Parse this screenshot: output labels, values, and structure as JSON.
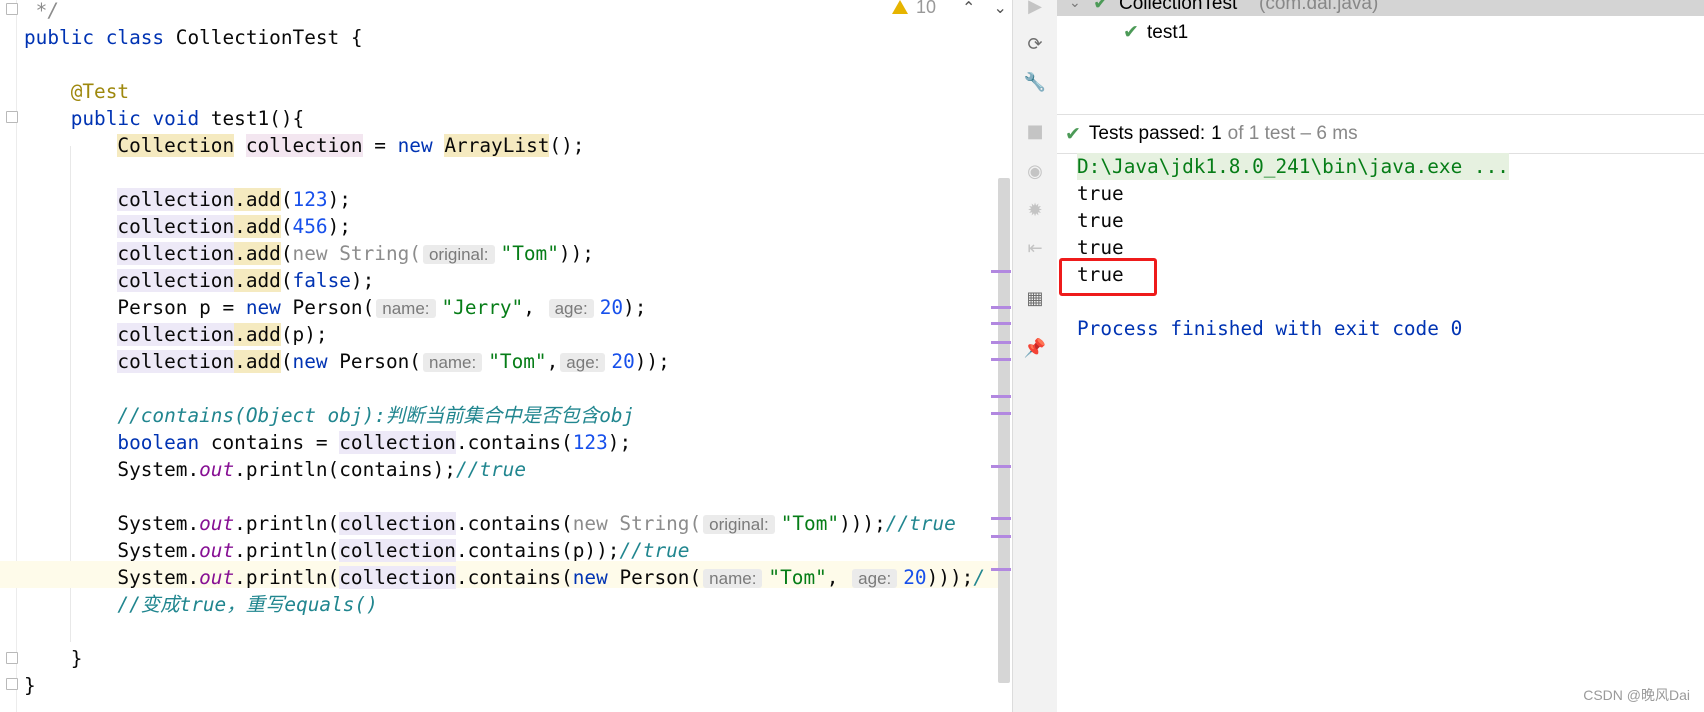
{
  "editor": {
    "lines": [
      {
        "segs": [
          {
            "t": " */",
            "c": "cmt"
          }
        ]
      },
      {
        "segs": [
          {
            "t": "public",
            "c": "kw"
          },
          {
            "t": " "
          },
          {
            "t": "class",
            "c": "kw"
          },
          {
            "t": " CollectionTest {"
          }
        ]
      },
      {
        "segs": []
      },
      {
        "segs": [
          {
            "t": "    "
          },
          {
            "t": "@Test",
            "c": "ann"
          }
        ]
      },
      {
        "segs": [
          {
            "t": "    "
          },
          {
            "t": "public",
            "c": "kw"
          },
          {
            "t": " "
          },
          {
            "t": "void",
            "c": "kw"
          },
          {
            "t": " test1(){"
          }
        ]
      },
      {
        "segs": [
          {
            "t": "        "
          },
          {
            "t": "Collection",
            "c": "hl-y"
          },
          {
            "t": " "
          },
          {
            "t": "collection",
            "c": "hl-p"
          },
          {
            "t": " = "
          },
          {
            "t": "new",
            "c": "kw"
          },
          {
            "t": " "
          },
          {
            "t": "ArrayList",
            "c": "hl-y"
          },
          {
            "t": "();"
          }
        ]
      },
      {
        "segs": []
      },
      {
        "segs": [
          {
            "t": "        "
          },
          {
            "t": "collection",
            "c": "hl-v"
          },
          {
            "t": ".add",
            "c": "hl-y"
          },
          {
            "t": "("
          },
          {
            "t": "123",
            "c": "num"
          },
          {
            "t": ");"
          }
        ]
      },
      {
        "segs": [
          {
            "t": "        "
          },
          {
            "t": "collection",
            "c": "hl-v"
          },
          {
            "t": ".add",
            "c": "hl-y"
          },
          {
            "t": "("
          },
          {
            "t": "456",
            "c": "num"
          },
          {
            "t": ");"
          }
        ]
      },
      {
        "segs": [
          {
            "t": "        "
          },
          {
            "t": "collection",
            "c": "hl-v"
          },
          {
            "t": ".add",
            "c": "hl-y"
          },
          {
            "t": "("
          },
          {
            "t": "new String(",
            "c": "gray"
          },
          {
            "t": "original:",
            "c": "hint"
          },
          {
            "t": "\"Tom\"",
            "c": "str"
          },
          {
            "t": "));"
          }
        ]
      },
      {
        "segs": [
          {
            "t": "        "
          },
          {
            "t": "collection",
            "c": "hl-v"
          },
          {
            "t": ".add",
            "c": "hl-y"
          },
          {
            "t": "("
          },
          {
            "t": "false",
            "c": "kw"
          },
          {
            "t": ");"
          }
        ]
      },
      {
        "segs": [
          {
            "t": "        Person p = "
          },
          {
            "t": "new",
            "c": "kw"
          },
          {
            "t": " Person("
          },
          {
            "t": "name:",
            "c": "hint"
          },
          {
            "t": "\"Jerry\"",
            "c": "str"
          },
          {
            "t": ", "
          },
          {
            "t": "age:",
            "c": "hint"
          },
          {
            "t": "20",
            "c": "num"
          },
          {
            "t": ");"
          }
        ]
      },
      {
        "segs": [
          {
            "t": "        "
          },
          {
            "t": "collection",
            "c": "hl-v"
          },
          {
            "t": ".add",
            "c": "hl-y"
          },
          {
            "t": "(p);"
          }
        ]
      },
      {
        "segs": [
          {
            "t": "        "
          },
          {
            "t": "collection",
            "c": "hl-v"
          },
          {
            "t": ".add",
            "c": "hl-y"
          },
          {
            "t": "("
          },
          {
            "t": "new",
            "c": "kw"
          },
          {
            "t": " Person("
          },
          {
            "t": "name:",
            "c": "hint"
          },
          {
            "t": "\"Tom\"",
            "c": "str"
          },
          {
            "t": ","
          },
          {
            "t": "age:",
            "c": "hint"
          },
          {
            "t": "20",
            "c": "num"
          },
          {
            "t": "));"
          }
        ]
      },
      {
        "segs": []
      },
      {
        "segs": [
          {
            "t": "        "
          },
          {
            "t": "//contains(Object obj):判断当前集合中是否包含obj",
            "c": "cmt2"
          }
        ]
      },
      {
        "segs": [
          {
            "t": "        "
          },
          {
            "t": "boolean",
            "c": "kw"
          },
          {
            "t": " contains = "
          },
          {
            "t": "collection",
            "c": "hl-v"
          },
          {
            "t": ".contains("
          },
          {
            "t": "123",
            "c": "num"
          },
          {
            "t": ");"
          }
        ]
      },
      {
        "segs": [
          {
            "t": "        System."
          },
          {
            "t": "out",
            "c": "fld"
          },
          {
            "t": ".println(contains);"
          },
          {
            "t": "//true",
            "c": "cmt2"
          }
        ]
      },
      {
        "segs": []
      },
      {
        "segs": [
          {
            "t": "        System."
          },
          {
            "t": "out",
            "c": "fld"
          },
          {
            "t": ".println("
          },
          {
            "t": "collection",
            "c": "hl-v"
          },
          {
            "t": ".contains("
          },
          {
            "t": "new String(",
            "c": "gray"
          },
          {
            "t": "original:",
            "c": "hint"
          },
          {
            "t": "\"Tom\"",
            "c": "str"
          },
          {
            "t": ")));"
          },
          {
            "t": "//true",
            "c": "cmt2"
          }
        ]
      },
      {
        "segs": [
          {
            "t": "        System."
          },
          {
            "t": "out",
            "c": "fld"
          },
          {
            "t": ".println("
          },
          {
            "t": "collection",
            "c": "hl-v"
          },
          {
            "t": ".contains(p));"
          },
          {
            "t": "//true",
            "c": "cmt2"
          }
        ]
      },
      {
        "segs": [
          {
            "t": "        System."
          },
          {
            "t": "out",
            "c": "fld"
          },
          {
            "t": ".println("
          },
          {
            "t": "collection",
            "c": "hl-v"
          },
          {
            "t": ".contains("
          },
          {
            "t": "new",
            "c": "kw"
          },
          {
            "t": " Person("
          },
          {
            "t": "name:",
            "c": "hint"
          },
          {
            "t": "\"Tom\"",
            "c": "str"
          },
          {
            "t": ", "
          },
          {
            "t": "age:",
            "c": "hint"
          },
          {
            "t": "20",
            "c": "num"
          },
          {
            "t": ")));"
          },
          {
            "t": "/",
            "c": "cmt2"
          }
        ]
      },
      {
        "segs": [
          {
            "t": "        "
          },
          {
            "t": "//变成true，重写equals()",
            "c": "cmt2"
          }
        ]
      },
      {
        "segs": []
      },
      {
        "segs": [
          {
            "t": "    }"
          }
        ]
      },
      {
        "segs": [
          {
            "t": "}"
          }
        ]
      }
    ],
    "warning_count": "10",
    "warning_icon": "warning-triangle-icon"
  },
  "toolstrip": {
    "icons": [
      "rerun-icon",
      "toggle-auto-test-icon",
      "settings-wrench-icon",
      "stop-icon",
      "camera-icon",
      "debug-disabled-icon",
      "import-tests-icon",
      "layout-icon",
      "pin-icon"
    ]
  },
  "run": {
    "tree": {
      "root_label": "CollectionTest",
      "root_package": "(com.dai.java)",
      "child_label": "test1"
    },
    "status": {
      "prefix": "Tests passed:",
      "count": "1",
      "suffix": "of 1 test – 6 ms"
    },
    "console": {
      "command": "D:\\Java\\jdk1.8.0_241\\bin\\java.exe ...",
      "outputs": [
        "true",
        "true",
        "true",
        "true"
      ],
      "exit": "Process finished with exit code 0"
    },
    "colors": {
      "pass": "#4c9a57",
      "highlight_box": "#ee1b1b"
    }
  },
  "watermark": "CSDN @晚风Dai"
}
